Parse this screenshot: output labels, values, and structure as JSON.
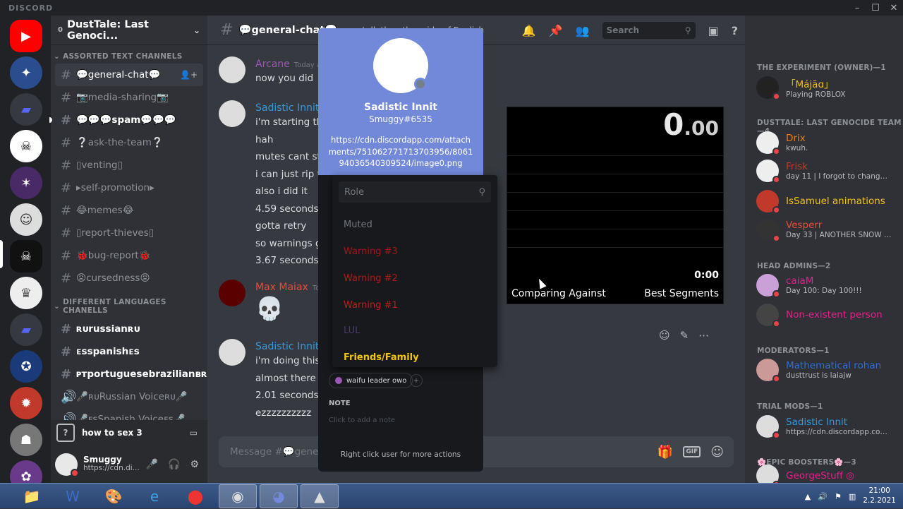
{
  "window": {
    "brand": "DISCORD",
    "minimize": "–",
    "maximize": "☐",
    "close": "✕"
  },
  "server": {
    "badge": "0",
    "name": "DustTale: Last Genoci...",
    "chevron": "❯"
  },
  "categories": {
    "text": "ASSORTED TEXT CHANNELS",
    "lang": "DIFFERENT LANGUAGES CHANELLS"
  },
  "channels": [
    {
      "name": "💬general-chat💬",
      "active": true
    },
    {
      "name": "📷media-sharing📷"
    },
    {
      "name": "💬💬💬spam💬💬💬",
      "bold": true,
      "unread": true
    },
    {
      "name": "❔ask-the-team❔"
    },
    {
      "name": "▯venting▯"
    },
    {
      "name": "▸self-promotion▸"
    },
    {
      "name": "😂memes😂"
    },
    {
      "name": "▯report-thieves▯"
    },
    {
      "name": "🐞bug-report🐞"
    },
    {
      "name": "😡cursedness😡"
    }
  ],
  "lang_channels": [
    {
      "name": "ʀᴜrussianʀᴜ",
      "bold": true
    },
    {
      "name": "ᴇsspanishᴇs",
      "bold": true
    },
    {
      "name": "ᴘᴛportuguesebrazilianʙʀ",
      "bold": true
    },
    {
      "name": "🎤ʀᴜRussian Voiceʀᴜ🎤",
      "voice": true
    },
    {
      "name": "🎤ᴇsSpanish Voiceᴇs🎤",
      "voice": true
    }
  ],
  "voice": {
    "label": "how to sex 3",
    "q": "?"
  },
  "user": {
    "name": "Smuggy",
    "sub": "https://cdn.di..."
  },
  "chat": {
    "channel": "💬general-chat💬",
    "topic": "we talk the other side of English",
    "search_placeholder": "Search",
    "input_placeholder": "Message #💬general-chat💬"
  },
  "messages": [
    {
      "author": "Arcane",
      "color": "#9b59b6",
      "time": "Today at 1:58",
      "lines": [
        "now you did"
      ]
    },
    {
      "author": "Sadistic Innit",
      "color": "#3498db",
      "time": "",
      "lines": [
        "i'm starting th",
        "hah",
        "mutes cant sto",
        "i can just rip th",
        "also i did it",
        "4.59 seconds",
        "gotta retry",
        "so warnings gi",
        "3.67 seconds"
      ]
    },
    {
      "author": "Max Maiax",
      "color": "#e74c3c",
      "time": "To",
      "lines": [
        "💀"
      ]
    },
    {
      "author": "Sadistic Innit",
      "color": "#3498db",
      "time": "",
      "lines": [
        "i'm doing this",
        "almost there",
        "2.01 seconds",
        "ezzzzzzzzzz"
      ]
    }
  ],
  "timer": {
    "main": "0",
    "decimals": ".00",
    "small": "0:00",
    "left_label": "Comparing Against",
    "right_label": "Best Segments"
  },
  "popout": {
    "name": "Sadistic Innit",
    "tag": "Smuggy#6535",
    "link": "https://cdn.discordapp.com/attachments/751062771713703956/806194036540309524/image0.png",
    "role_pill": "waifu leader owo",
    "note_label": "NOTE",
    "note_placeholder": "Click to add a note",
    "footer": "Right click user for more actions"
  },
  "role_menu": {
    "placeholder": "Role",
    "items": [
      {
        "label": "Muted",
        "color": "#72767d"
      },
      {
        "label": "Warning #3",
        "color": "#a01818"
      },
      {
        "label": "Warning #2",
        "color": "#a81c1c"
      },
      {
        "label": "Warning #1",
        "color": "#b52020"
      },
      {
        "label": "LUL",
        "color": "#4a3a66"
      },
      {
        "label": "Friends/Family",
        "color": "#f1c40f"
      }
    ]
  },
  "members": {
    "cat1": "THE EXPERIMENT (OWNER)—1",
    "cat2": "DUSTTALE: LAST GENOCIDE TEAM—4",
    "cat3": "HEAD ADMINS—2",
    "cat4": "MODERATORS—1",
    "cat5": "TRIAL MODS—1",
    "cat6": "🌸EPIC BOOSTERS🌸—3",
    "list": [
      {
        "name": "「Májāɑ」",
        "color": "#f1c40f",
        "act": "Playing ROBLOX"
      },
      {
        "name": "Drix",
        "color": "#e67e22",
        "act": "kwuh."
      },
      {
        "name": "Frisk",
        "color": "#c0392b",
        "act": "day 11 | I forgot to change my s..."
      },
      {
        "name": "IsSamuel animations",
        "color": "#f1c40f",
        "act": ""
      },
      {
        "name": "Vesperr",
        "color": "#e74c3c",
        "act": "Day 33 | ANOTHER SNOW D..."
      },
      {
        "name": "caiaM",
        "color": "#e91e8c",
        "act": "Day 100: Day 100!!!"
      },
      {
        "name": "Non-existent person",
        "color": "#e91e8c",
        "act": ""
      },
      {
        "name": "Mathematical rohan",
        "color": "#2f6fd6",
        "act": "dusttrust is laiajw"
      },
      {
        "name": "Sadistic Innit",
        "color": "#3498db",
        "act": "https://cdn.discordapp.com/..."
      },
      {
        "name": "GeorgeStuff ◎",
        "color": "#e91e8c",
        "act": ""
      }
    ]
  },
  "taskbar": {
    "time": "21:00",
    "date": "2.2.2021"
  },
  "colors": {
    "blurple": "#7289da",
    "bg": "#36393f",
    "sidebar": "#2f3136",
    "guilds": "#202225"
  }
}
